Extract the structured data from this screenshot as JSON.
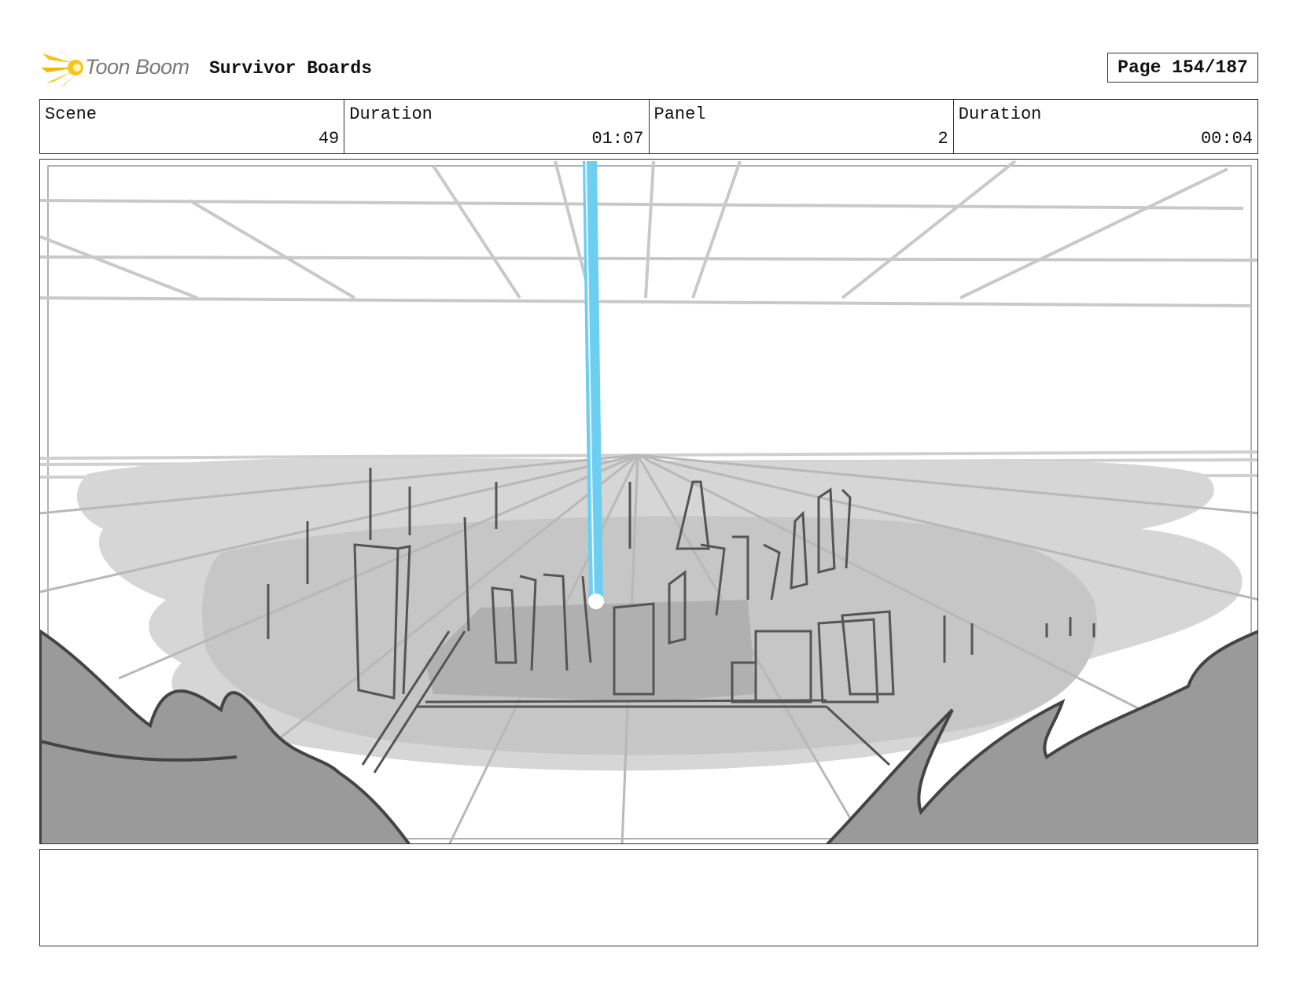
{
  "header": {
    "logo_text": "Toon Boom",
    "project_title": "Survivor Boards",
    "page_label": "Page 154/187"
  },
  "info": {
    "scene_label": "Scene",
    "scene_value": "49",
    "scene_duration_label": "Duration",
    "scene_duration_value": "01:07",
    "panel_label": "Panel",
    "panel_value": "2",
    "panel_duration_label": "Duration",
    "panel_duration_value": "00:04"
  },
  "notes": {
    "text": ""
  },
  "colors": {
    "beam": "#6ccff2",
    "logo_yellow": "#f5c518",
    "sketch_dark": "#555555",
    "sketch_light": "#c8c8c8"
  }
}
